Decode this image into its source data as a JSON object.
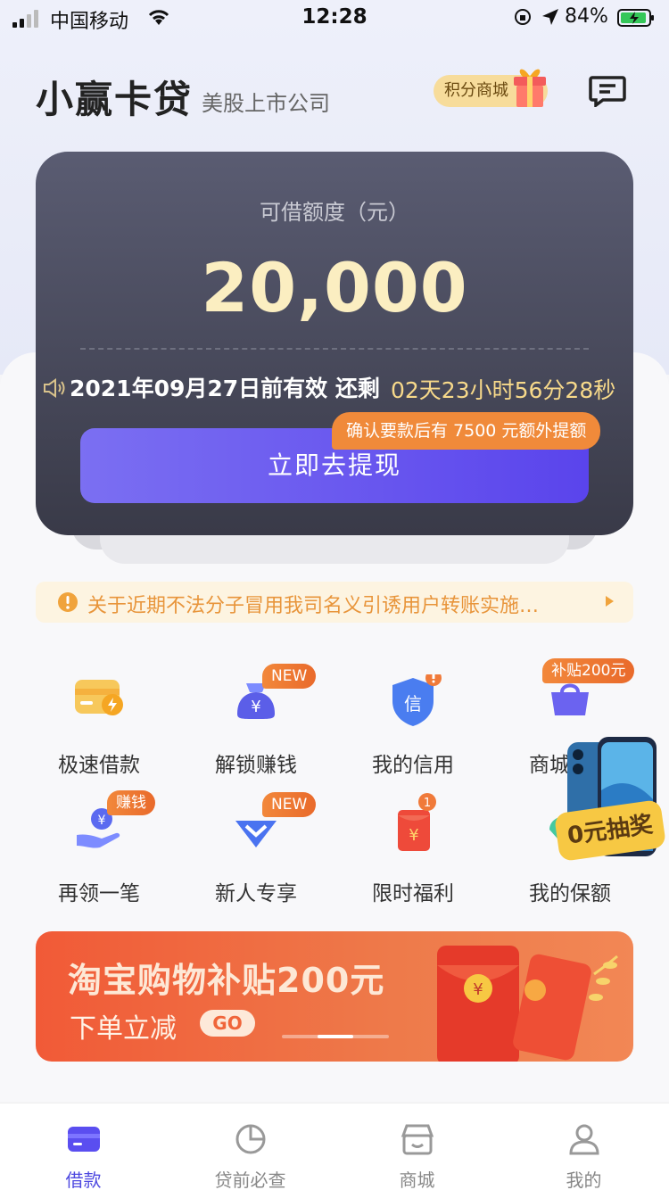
{
  "status_bar": {
    "carrier": "中国移动",
    "time": "12:28",
    "battery": "84%"
  },
  "header": {
    "brand": "小赢卡贷",
    "brand_sub": "美股上市公司",
    "points_mall": "积分商城"
  },
  "card": {
    "quota_label": "可借额度（元）",
    "quota_value": "20,000",
    "validity": "2021年09月27日前有效 还剩",
    "countdown": "02天23小时56分28秒",
    "cta": "立即去提现",
    "cta_tip": "确认要款后有 7500 元额外提额"
  },
  "notice": {
    "text": "关于近期不法分子冒用我司名义引诱用户转账实施…"
  },
  "grid": [
    {
      "label": "极速借款",
      "tag": ""
    },
    {
      "label": "解锁赚钱",
      "tag": "NEW"
    },
    {
      "label": "我的信用",
      "tag": ""
    },
    {
      "label": "商城购物",
      "tag": "补贴200元"
    },
    {
      "label": "再领一笔",
      "tag": "赚钱"
    },
    {
      "label": "新人专享",
      "tag": "NEW"
    },
    {
      "label": "限时福利",
      "tag": ""
    },
    {
      "label": "我的保额",
      "tag": ""
    }
  ],
  "promo_float": {
    "text": "0元抽奖"
  },
  "banner": {
    "title": "淘宝购物补贴200元",
    "subtitle": "下单立减",
    "go": "GO"
  },
  "tabbar": [
    {
      "label": "借款",
      "icon": "card-icon"
    },
    {
      "label": "贷前必查",
      "icon": "pie-chart-icon"
    },
    {
      "label": "商城",
      "icon": "store-icon"
    },
    {
      "label": "我的",
      "icon": "user-icon"
    }
  ],
  "colors": {
    "accent": "#5a44ec",
    "gold": "#fbeec1",
    "orange": "#f08a3a",
    "card_bg": "#45475a"
  }
}
